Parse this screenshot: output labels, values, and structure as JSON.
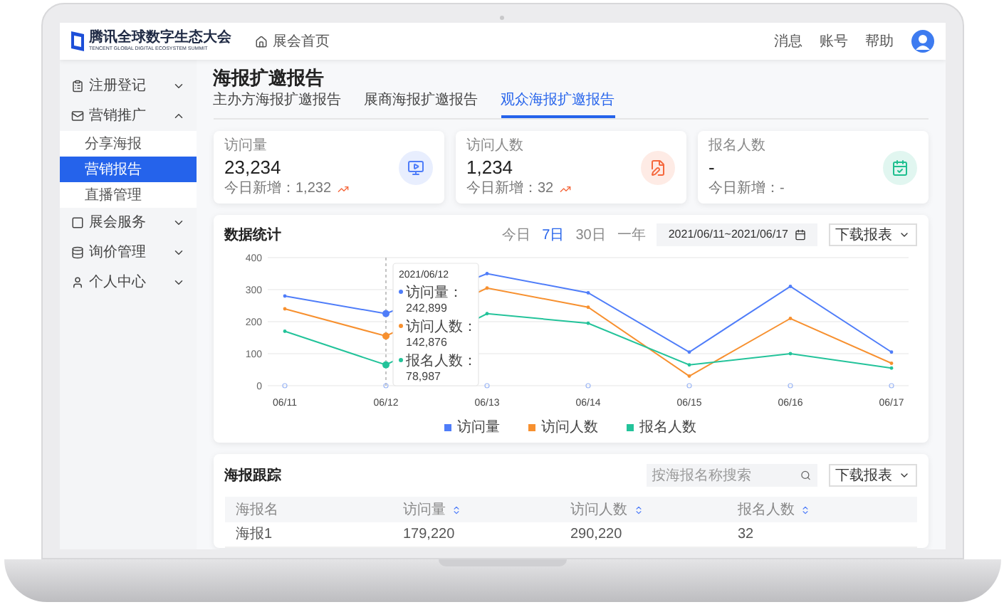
{
  "header": {
    "logo_title": "腾讯全球数字生态大会",
    "logo_subtitle": "TENCENT GLOBAL DIGITAL ECOSYSTEM SUMMIT",
    "home_link": "展会首页",
    "links": [
      "消息",
      "账号",
      "帮助"
    ]
  },
  "sidebar": {
    "items": [
      {
        "label": "注册登记",
        "expanded": false
      },
      {
        "label": "营销推广",
        "expanded": true,
        "children": [
          {
            "label": "分享海报",
            "selected": false
          },
          {
            "label": "营销报告",
            "selected": true
          },
          {
            "label": "直播管理",
            "selected": false
          }
        ]
      },
      {
        "label": "展会服务",
        "expanded": false
      },
      {
        "label": "询价管理",
        "expanded": false
      },
      {
        "label": "个人中心",
        "expanded": false
      }
    ]
  },
  "page_title": "海报扩邀报告",
  "tabs": [
    {
      "label": "主办方海报扩邀报告",
      "selected": false
    },
    {
      "label": "展商海报扩邀报告",
      "selected": false
    },
    {
      "label": "观众海报扩邀报告",
      "selected": true
    }
  ],
  "stats": [
    {
      "label": "访问量",
      "value": "23,234",
      "today": "今日新增：1,232",
      "rising": true,
      "color": "#4f7df9"
    },
    {
      "label": "访问人数",
      "value": "1,234",
      "today": "今日新增：32",
      "rising": true,
      "color": "#f5683d"
    },
    {
      "label": "报名人数",
      "value": "-",
      "today": "今日新增：-",
      "rising": false,
      "color": "#1fbf8f"
    }
  ],
  "data_stats": {
    "title": "数据统计",
    "ranges": [
      {
        "label": "今日",
        "selected": false
      },
      {
        "label": "7日",
        "selected": true
      },
      {
        "label": "30日",
        "selected": false
      },
      {
        "label": "一年",
        "selected": false
      }
    ],
    "date_range": "2021/06/11~2021/06/17",
    "download": "下载报表",
    "chart_data": {
      "type": "line",
      "grid": true,
      "ref_lines": [
        {
          "axis": "x",
          "value": "06/12"
        }
      ],
      "categories": [
        "06/11",
        "06/12",
        "06/13",
        "06/14",
        "06/15",
        "06/16",
        "06/17"
      ],
      "ylim": [
        0,
        400
      ],
      "yticks": [
        0,
        100,
        200,
        300,
        400
      ],
      "series": [
        {
          "name": "访问量",
          "color": "#4f7df9",
          "values": [
            280,
            225,
            350,
            290,
            105,
            310,
            105
          ]
        },
        {
          "name": "访问人数",
          "color": "#f7902f",
          "values": [
            240,
            155,
            305,
            245,
            30,
            210,
            70
          ]
        },
        {
          "name": "报名人数",
          "color": "#23c39a",
          "values": [
            170,
            65,
            225,
            195,
            65,
            100,
            55
          ]
        }
      ]
    },
    "tooltip": {
      "title": "2021/06/12",
      "rows": [
        {
          "label": "访问量：",
          "value": "242,899",
          "color": "#4f7df9"
        },
        {
          "label": "访问人数：",
          "value": "142,876",
          "color": "#f7902f"
        },
        {
          "label": "报名人数：",
          "value": "78,987",
          "color": "#23c39a"
        }
      ]
    }
  },
  "tracking": {
    "title": "海报跟踪",
    "search": {
      "placeholder": "按海报名称搜索"
    },
    "download": "下载报表",
    "columns": [
      {
        "label": "海报名",
        "sortable": false
      },
      {
        "label": "访问量",
        "sortable": true
      },
      {
        "label": "访问人数",
        "sortable": true
      },
      {
        "label": "报名人数",
        "sortable": true
      }
    ],
    "rows": [
      [
        "海报1",
        "179,220",
        "290,220",
        "32"
      ]
    ]
  }
}
